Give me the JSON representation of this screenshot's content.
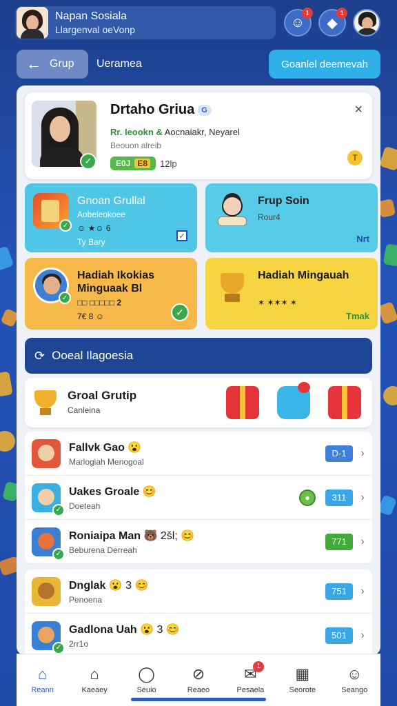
{
  "header": {
    "user_name": "Napan Sosiala",
    "user_subtitle": "Llargenval oeVonp",
    "notifications": [
      {
        "icon": "chat-icon",
        "badge": "1"
      },
      {
        "icon": "diamond-icon",
        "badge": "1"
      }
    ]
  },
  "nav": {
    "back_label": "Grup",
    "title": "Ueramea",
    "cta_label": "Goanlel deemevah"
  },
  "profile_card": {
    "name": "Drtaho Griua",
    "tag": "G",
    "line_green": "Rr. Ieookn &",
    "line_rest": "Aocnaiakr, Neyarel",
    "description": "Beouon alreib",
    "points_label": "E0J",
    "points_mini": "E8",
    "points_count": "12lp",
    "close_symbol": "×",
    "coin_symbol": "T"
  },
  "tiles": [
    {
      "title": "Gnoan Grullal",
      "sub1": "Aobeleokoee",
      "sub2": "☺ ★☺ 6",
      "sub3": "Ty Bary",
      "corner": "✓"
    },
    {
      "title": "Frup Soin",
      "sub1": "Rour4",
      "corner": "Nrt"
    },
    {
      "title": "Hadiah Ikokias Minguaak Bl",
      "sub1": "□□ □□□□□ 2",
      "sub2": "7€ 8 ☺",
      "corner": "✓"
    },
    {
      "title": "Hadiah Mingauah",
      "sub1": "✶ ✶✶✶ ✶",
      "corner": "Tmak"
    }
  ],
  "section": {
    "icon": "refresh-icon",
    "title": "Ooeal Ilagoesia"
  },
  "group_card": {
    "title": "Groal Grutip",
    "subtitle": "Canleina"
  },
  "list": [
    {
      "title": "Fallvk Gao",
      "emoji": "😮",
      "subtitle": "Marlogiah Menogoal",
      "badge": "D-1",
      "badge_color": "#3f7fd6",
      "arrow": "›"
    },
    {
      "title": "Uakes Groale",
      "emoji": "😊",
      "subtitle": "Doeteah",
      "badge": "311",
      "badge_color": "#3aa6e6",
      "arrow": "›"
    },
    {
      "title": "Roniaipa Man",
      "emoji": "🐻 2šl; 😊",
      "subtitle": "Beburena Derreah",
      "badge": "771",
      "badge_color": "#43a93d",
      "arrow": "›"
    },
    {
      "title": "Dnglak",
      "emoji": "😮 3 😊",
      "subtitle": "Penoena",
      "badge": "751",
      "badge_color": "#3aa6e6",
      "arrow": "›"
    },
    {
      "title": "Gadlona Uah",
      "emoji": "😮 3 😊",
      "subtitle": "2rr1o",
      "badge": "501",
      "badge_color": "#3aa6e6",
      "arrow": "›"
    }
  ],
  "bottom_nav": [
    {
      "label": "Reann",
      "icon": "home-icon"
    },
    {
      "label": "Kaeaey",
      "icon": "house-icon"
    },
    {
      "label": "Seuio",
      "icon": "user-icon"
    },
    {
      "label": "Reaeo",
      "icon": "compass-icon"
    },
    {
      "label": "Pesaela",
      "icon": "mail-icon",
      "badge": "1"
    },
    {
      "label": "Seorote",
      "icon": "calendar-icon"
    },
    {
      "label": "Seango",
      "icon": "profile-icon"
    }
  ]
}
